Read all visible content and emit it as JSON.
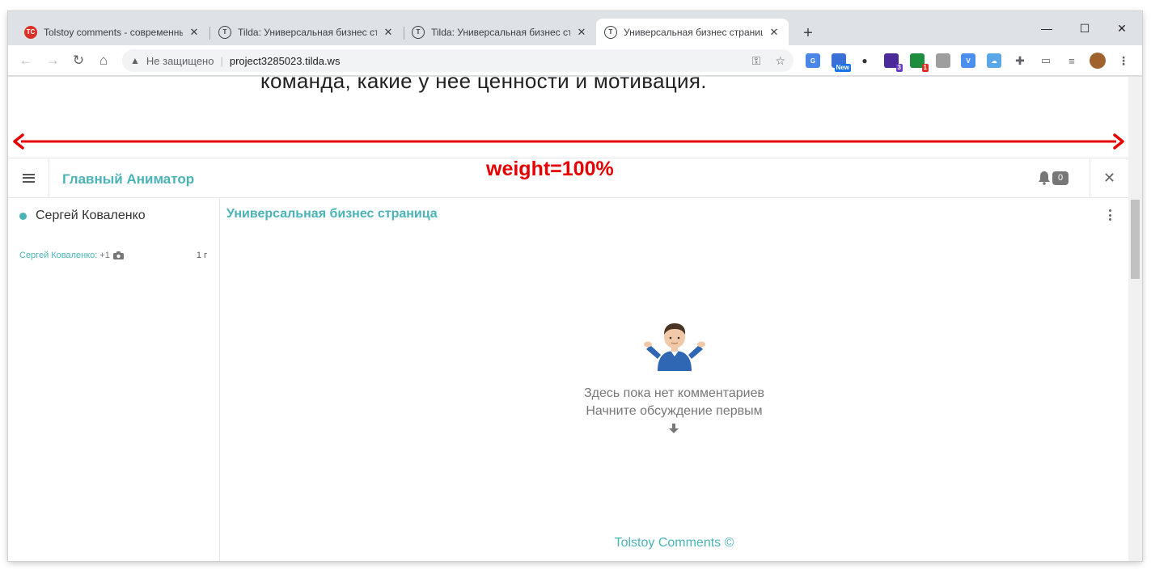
{
  "browser": {
    "tabs": [
      {
        "title": "Tolstoy comments - современны",
        "favicon_text": "TC",
        "active": false
      },
      {
        "title": "Tilda: Универсальная бизнес стр",
        "favicon_text": "T",
        "active": false
      },
      {
        "title": "Tilda: Универсальная бизнес стр",
        "favicon_text": "T",
        "active": false
      },
      {
        "title": "Универсальная бизнес страниц",
        "favicon_text": "T",
        "active": true
      }
    ],
    "new_tab": "+",
    "window_controls": {
      "minimize": "—",
      "maximize": "☐",
      "close": "✕"
    },
    "security_label": "Не защищено",
    "url": "project3285023.tilda.ws",
    "extension_badges": {
      "new": "New",
      "count_a": "3",
      "count_b": "1"
    }
  },
  "page": {
    "visible_text": "команда, какие у нее ценности и мотивация.",
    "annotation": "weight=100%"
  },
  "widget": {
    "channel_title": "Главный Аниматор",
    "notification_count": "0",
    "sidebar": {
      "user_name": "Сергей Коваленко",
      "last_message": {
        "author": "Сергей Коваленко:",
        "extra": "+1",
        "age": "1 г"
      }
    },
    "main": {
      "page_title": "Универсальная бизнес страница",
      "empty_title": "Здесь пока нет комментариев",
      "empty_subtitle": "Начните обсуждение первым"
    },
    "footer": "Tolstoy Comments ©"
  },
  "colors": {
    "accent": "#4ab3b8",
    "annotation": "#e60000"
  }
}
